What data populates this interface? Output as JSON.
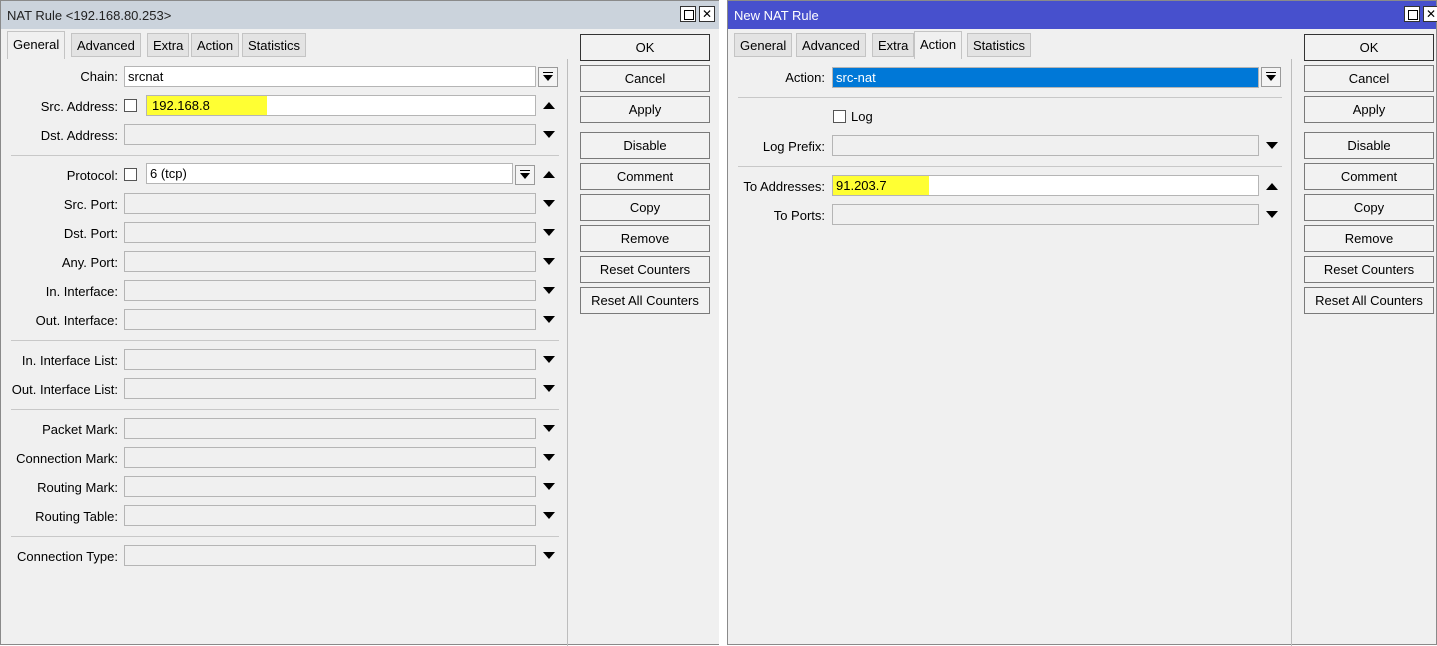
{
  "left_window": {
    "title": "NAT Rule <192.168.80.253>",
    "tabs": [
      "General",
      "Advanced",
      "Extra",
      "Action",
      "Statistics"
    ],
    "selected_tab": "General",
    "fields": {
      "chain": {
        "label": "Chain:",
        "value": "srcnat"
      },
      "src_address": {
        "label": "Src. Address:",
        "value": "192.168.8"
      },
      "dst_address": {
        "label": "Dst. Address:",
        "value": ""
      },
      "protocol": {
        "label": "Protocol:",
        "value": "6 (tcp)"
      },
      "src_port": {
        "label": "Src. Port:",
        "value": ""
      },
      "dst_port": {
        "label": "Dst. Port:",
        "value": ""
      },
      "any_port": {
        "label": "Any. Port:",
        "value": ""
      },
      "in_interface": {
        "label": "In. Interface:",
        "value": ""
      },
      "out_interface": {
        "label": "Out. Interface:",
        "value": ""
      },
      "in_interface_list": {
        "label": "In. Interface List:",
        "value": ""
      },
      "out_interface_list": {
        "label": "Out. Interface List:",
        "value": ""
      },
      "packet_mark": {
        "label": "Packet Mark:",
        "value": ""
      },
      "connection_mark": {
        "label": "Connection Mark:",
        "value": ""
      },
      "routing_mark": {
        "label": "Routing Mark:",
        "value": ""
      },
      "routing_table": {
        "label": "Routing Table:",
        "value": ""
      },
      "connection_type": {
        "label": "Connection Type:",
        "value": ""
      }
    },
    "buttons": [
      "OK",
      "Cancel",
      "Apply",
      "Disable",
      "Comment",
      "Copy",
      "Remove",
      "Reset Counters",
      "Reset All Counters"
    ]
  },
  "right_window": {
    "title": "New NAT Rule",
    "tabs": [
      "General",
      "Advanced",
      "Extra",
      "Action",
      "Statistics"
    ],
    "selected_tab": "Action",
    "fields": {
      "action": {
        "label": "Action:",
        "value": "src-nat"
      },
      "log": {
        "label": "Log"
      },
      "log_prefix": {
        "label": "Log Prefix:",
        "value": ""
      },
      "to_addresses": {
        "label": "To Addresses:",
        "value": "91.203.7"
      },
      "to_ports": {
        "label": "To Ports:",
        "value": ""
      }
    },
    "buttons": [
      "OK",
      "Cancel",
      "Apply",
      "Disable",
      "Comment",
      "Copy",
      "Remove",
      "Reset Counters",
      "Reset All Counters"
    ]
  },
  "colors": {
    "active_title": "#4750cd",
    "inactive_title": "#cbd3dc",
    "highlight": "#ffff33",
    "selection": "#0078d7"
  }
}
